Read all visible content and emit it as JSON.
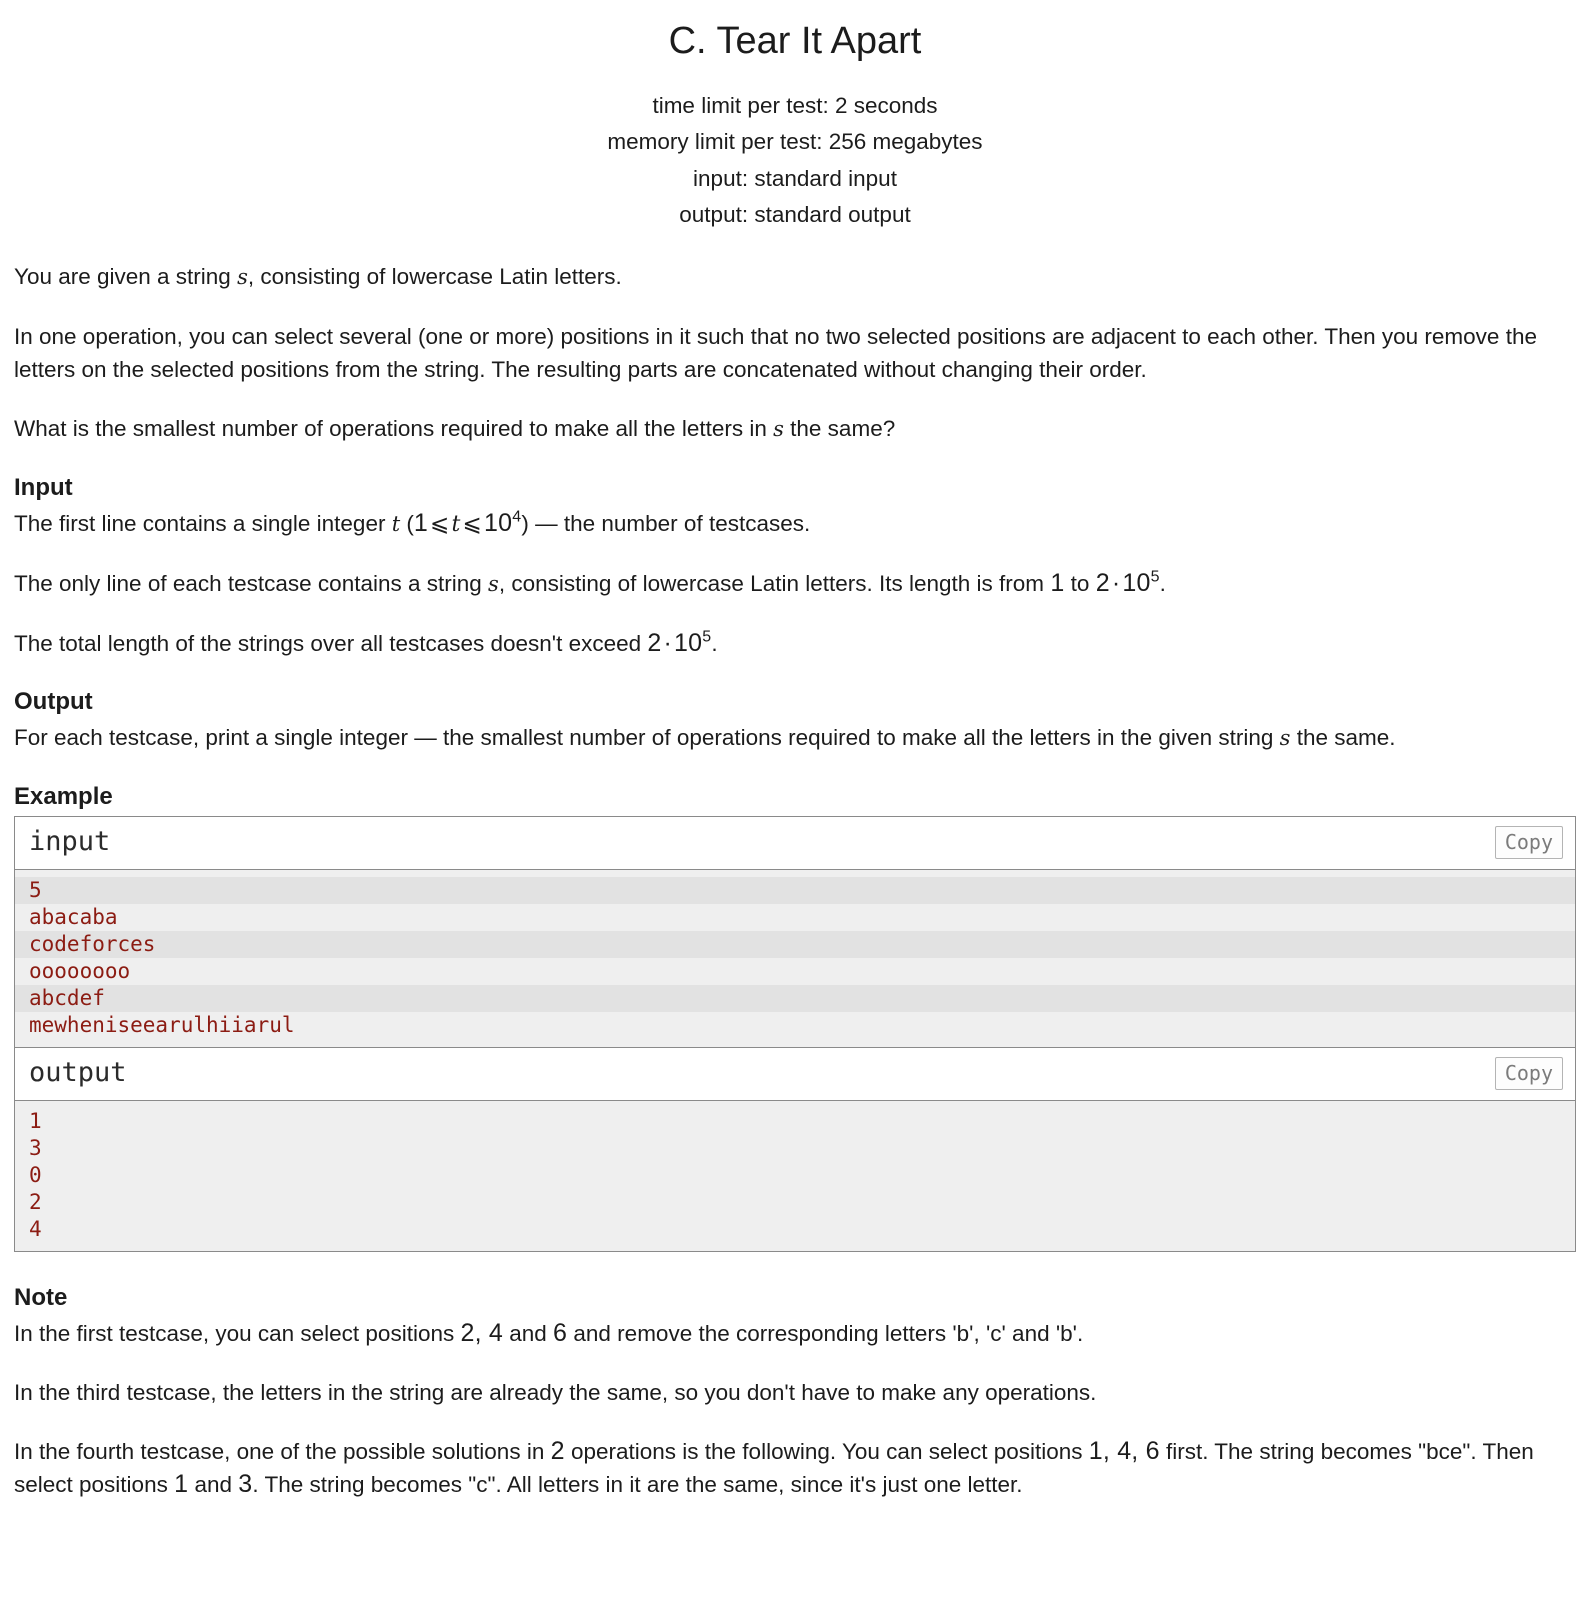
{
  "header": {
    "title": "C. Tear It Apart",
    "limits": [
      "time limit per test: 2 seconds",
      "memory limit per test: 256 megabytes",
      "input: standard input",
      "output: standard output"
    ]
  },
  "statement": {
    "p1_a": "You are given a string ",
    "p1_var": "s",
    "p1_b": ", consisting of lowercase Latin letters.",
    "p2": "In one operation, you can select several (one or more) positions in it such that no two selected positions are adjacent to each other. Then you remove the letters on the selected positions from the string. The resulting parts are concatenated without changing their order.",
    "p3_a": "What is the smallest number of operations required to make all the letters in ",
    "p3_var": "s",
    "p3_b": " the same?"
  },
  "input_section": {
    "heading": "Input",
    "p1_a": "The first line contains a single integer ",
    "p1_var": "t",
    "p1_b": " (",
    "p1_math_1": "1",
    "p1_math_rel1": "⩽",
    "p1_math_var": "t",
    "p1_math_rel2": "⩽",
    "p1_math_base": "10",
    "p1_math_exp": "4",
    "p1_c": ") — the number of testcases.",
    "p2_a": "The only line of each testcase contains a string ",
    "p2_var": "s",
    "p2_b": ", consisting of lowercase Latin letters. Its length is from ",
    "p2_math_1": "1",
    "p2_mid": " to ",
    "p2_math_2": "2",
    "p2_math_dot": "·",
    "p2_math_base": "10",
    "p2_math_exp": "5",
    "p2_c": ".",
    "p3_a": "The total length of the strings over all testcases doesn't exceed ",
    "p3_math_2": "2",
    "p3_math_dot": "·",
    "p3_math_base": "10",
    "p3_math_exp": "5",
    "p3_b": "."
  },
  "output_section": {
    "heading": "Output",
    "p1_a": "For each testcase, print a single integer — the smallest number of operations required to make all the letters in the given string ",
    "p1_var": "s",
    "p1_b": " the same."
  },
  "example": {
    "heading": "Example",
    "input_label": "input",
    "output_label": "output",
    "copy_label": "Copy",
    "input_lines": [
      "5",
      "abacaba",
      "codeforces",
      "oooooooo",
      "abcdef",
      "mewheniseearulhiiarul"
    ],
    "output_lines": [
      "1",
      "3",
      "0",
      "2",
      "4"
    ]
  },
  "note_section": {
    "heading": "Note",
    "n1_a": "In the first testcase, you can select positions ",
    "n1_math_1": "2, 4",
    "n1_mid": " and ",
    "n1_math_2": "6",
    "n1_b": " and remove the corresponding letters 'b', 'c' and 'b'.",
    "n2": "In the third testcase, the letters in the string are already the same, so you don't have to make any operations.",
    "n3_a": "In the fourth testcase, one of the possible solutions in ",
    "n3_math_1": "2",
    "n3_b": " operations is the following. You can select positions ",
    "n3_math_2": "1, 4, 6",
    "n3_c": " first. The string becomes \"bce\". Then select positions ",
    "n3_math_3": "1",
    "n3_mid": " and ",
    "n3_math_4": "3",
    "n3_d": ". The string becomes \"c\". All letters in it are the same, since it's just one letter."
  },
  "colors": {
    "sample_text": "#8c1c13",
    "sample_bg": "#efefef",
    "sample_stripe": "#e2e2e2",
    "border": "#8a8a8a",
    "copy_text": "#7b7b7b"
  }
}
